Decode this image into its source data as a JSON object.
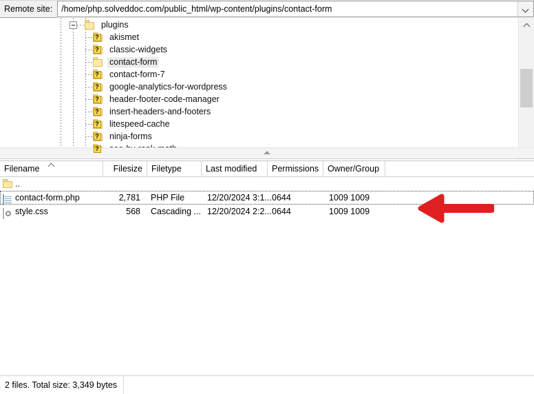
{
  "addressbar": {
    "label": "Remote site:",
    "path": "/home/php.solveddoc.com/public_html/wp-content/plugins/contact-form",
    "dropdown_icon": "chevron-down-icon"
  },
  "tree": {
    "root": {
      "label": "plugins",
      "icon": "folder-icon",
      "depth": 0,
      "expanded": true
    },
    "items": [
      {
        "label": "akismet",
        "icon": "folder-unknown-icon",
        "selected": false
      },
      {
        "label": "classic-widgets",
        "icon": "folder-unknown-icon",
        "selected": false
      },
      {
        "label": "contact-form",
        "icon": "folder-icon",
        "selected": true
      },
      {
        "label": "contact-form-7",
        "icon": "folder-unknown-icon",
        "selected": false
      },
      {
        "label": "google-analytics-for-wordpress",
        "icon": "folder-unknown-icon",
        "selected": false
      },
      {
        "label": "header-footer-code-manager",
        "icon": "folder-unknown-icon",
        "selected": false
      },
      {
        "label": "insert-headers-and-footers",
        "icon": "folder-unknown-icon",
        "selected": false
      },
      {
        "label": "litespeed-cache",
        "icon": "folder-unknown-icon",
        "selected": false
      },
      {
        "label": "ninja-forms",
        "icon": "folder-unknown-icon",
        "selected": false
      },
      {
        "label": "seo-by-rank-math",
        "icon": "folder-unknown-icon",
        "selected": false
      }
    ],
    "scrollbar": {
      "up_icon": "scroll-up-arrow-icon",
      "down_icon": "scroll-down-arrow-icon"
    }
  },
  "filelist": {
    "columns": [
      {
        "key": "filename",
        "label": "Filename",
        "sorted": true,
        "sort_icon": "sort-ascending-caret-icon"
      },
      {
        "key": "filesize",
        "label": "Filesize"
      },
      {
        "key": "filetype",
        "label": "Filetype"
      },
      {
        "key": "modified",
        "label": "Last modified"
      },
      {
        "key": "permissions",
        "label": "Permissions"
      },
      {
        "key": "owner",
        "label": "Owner/Group"
      }
    ],
    "rows": [
      {
        "filename": "..",
        "icon": "folder-up-icon",
        "filesize": "",
        "filetype": "",
        "modified": "",
        "permissions": "",
        "owner": "",
        "focused": false
      },
      {
        "filename": "contact-form.php",
        "icon": "php-file-icon",
        "filesize": "2,781",
        "filetype": "PHP File",
        "modified": "12/20/2024 3:1...",
        "permissions": "0644",
        "owner": "1009 1009",
        "focused": true
      },
      {
        "filename": "style.css",
        "icon": "css-file-icon",
        "filesize": "568",
        "filetype": "Cascading ...",
        "modified": "12/20/2024 2:2...",
        "permissions": "0644",
        "owner": "1009 1009",
        "focused": false
      }
    ]
  },
  "annotation": {
    "arrow": {
      "name": "red-left-arrow-annotation",
      "color": "#e02020",
      "direction": "left"
    }
  },
  "statusbar": {
    "text": "2 files. Total size: 3,349 bytes"
  }
}
